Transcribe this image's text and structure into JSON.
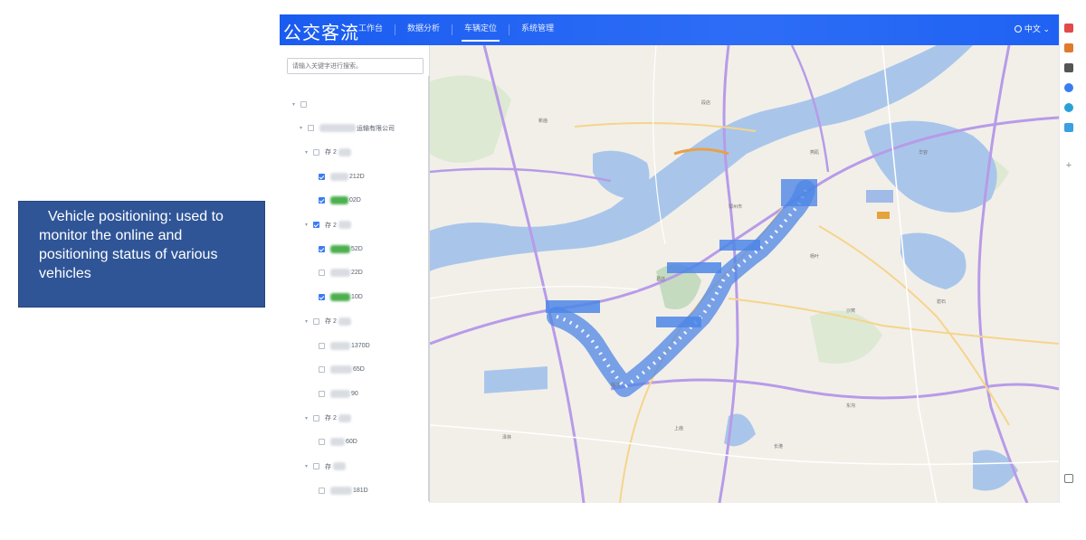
{
  "caption": {
    "text": "Vehicle positioning: used to monitor the online and positioning status of various vehicles"
  },
  "header": {
    "app_title": "公交客流",
    "nav": [
      {
        "label": "工作台",
        "active": false
      },
      {
        "label": "数据分析",
        "active": false
      },
      {
        "label": "车辆定位",
        "active": true
      },
      {
        "label": "系统管理",
        "active": false
      }
    ],
    "language": "中文",
    "accent_color": "#1f62f3"
  },
  "sidebar": {
    "search_placeholder": "请输入关键字进行搜索。",
    "tree": [
      {
        "level": 0,
        "text": "",
        "checked": false,
        "caret": true
      },
      {
        "level": 1,
        "text": "运输有限公司",
        "checked": false,
        "caret": true
      },
      {
        "level": 2,
        "text": "存 2",
        "checked": false,
        "caret": true
      },
      {
        "level": 3,
        "text": "212D",
        "checked": true,
        "caret": false,
        "online": false
      },
      {
        "level": 3,
        "text": "02D",
        "checked": true,
        "caret": false,
        "online": true
      },
      {
        "level": 2,
        "text": "存 2",
        "checked": true,
        "caret": true
      },
      {
        "level": 3,
        "text": "52D",
        "checked": true,
        "caret": false,
        "online": true
      },
      {
        "level": 3,
        "text": "22D",
        "checked": false,
        "caret": false,
        "online": false
      },
      {
        "level": 3,
        "text": "10D",
        "checked": true,
        "caret": false,
        "online": true
      },
      {
        "level": 2,
        "text": "存 2",
        "checked": false,
        "caret": true
      },
      {
        "level": 3,
        "text": "1370D",
        "checked": false,
        "caret": false,
        "online": false
      },
      {
        "level": 3,
        "text": "65D",
        "checked": false,
        "caret": false,
        "online": false
      },
      {
        "level": 3,
        "text": "90",
        "checked": false,
        "caret": false,
        "online": false
      },
      {
        "level": 2,
        "text": "存 2",
        "checked": false,
        "caret": true
      },
      {
        "level": 3,
        "text": "60D",
        "checked": false,
        "caret": false,
        "online": false
      },
      {
        "level": 2,
        "text": "存",
        "checked": false,
        "caret": true
      },
      {
        "level": 3,
        "text": "181D",
        "checked": false,
        "caret": false,
        "online": false
      }
    ]
  },
  "map": {
    "place_labels": [
      "鄂州市",
      "葛店",
      "临江",
      "华容",
      "东沟",
      "沙窝",
      "上庙",
      "杨叶",
      "新庙",
      "段店",
      "燕矶",
      "泽林",
      "碧石",
      "长港"
    ],
    "colors": {
      "water": "#a9c6ea",
      "green": "#c4dbc0",
      "road_major": "#b79be8",
      "road_main": "#f5d58a",
      "vehicle_cluster": "#4e86e6"
    }
  }
}
